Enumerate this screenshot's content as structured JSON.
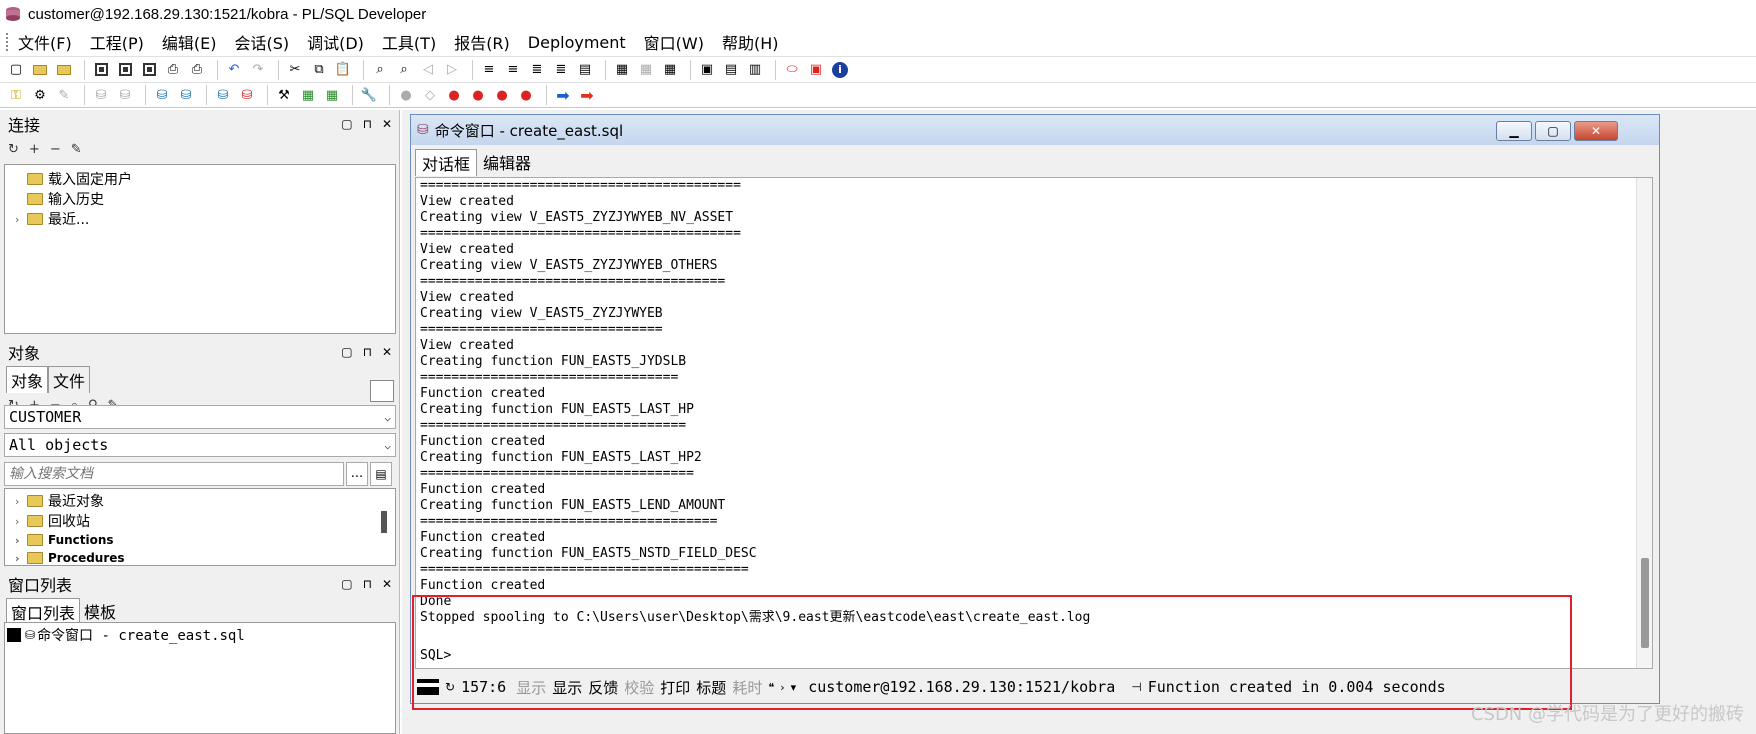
{
  "window": {
    "title": "customer@192.168.29.130:1521/kobra - PL/SQL Developer"
  },
  "menu": [
    "文件(F)",
    "工程(P)",
    "编辑(E)",
    "会话(S)",
    "调试(D)",
    "工具(T)",
    "报告(R)",
    "Deployment",
    "窗口(W)",
    "帮助(H)"
  ],
  "connection_panel": {
    "title": "连接",
    "tree": [
      {
        "label": "载入固定用户",
        "expandable": false
      },
      {
        "label": "输入历史",
        "expandable": false
      },
      {
        "label": "最近...",
        "expandable": true
      }
    ]
  },
  "objects_panel": {
    "title": "对象",
    "tabs": [
      "对象",
      "文件"
    ],
    "owner": "CUSTOMER",
    "filter": "All objects",
    "search_placeholder": "输入搜索文档",
    "search_more": "...",
    "tree": [
      {
        "label": "最近对象"
      },
      {
        "label": "回收站"
      },
      {
        "label": "Functions"
      },
      {
        "label": "Procedures"
      }
    ]
  },
  "windowlist_panel": {
    "title": "窗口列表",
    "tabs": [
      "窗口列表",
      "模板"
    ],
    "items": [
      "命令窗口 - create_east.sql"
    ]
  },
  "command_window": {
    "title": "命令窗口 - create_east.sql",
    "tabs": [
      "对话框",
      "编辑器"
    ],
    "output_lines": [
      "=========================================",
      "View created",
      "Creating view V_EAST5_ZYZJYWYEB_NV_ASSET",
      "=========================================",
      "View created",
      "Creating view V_EAST5_ZYZJYWYEB_OTHERS",
      "=======================================",
      "View created",
      "Creating view V_EAST5_ZYZJYWYEB",
      "===============================",
      "View created",
      "Creating function FUN_EAST5_JYDSLB",
      "=================================",
      "Function created",
      "Creating function FUN_EAST5_LAST_HP",
      "==================================",
      "Function created",
      "Creating function FUN_EAST5_LAST_HP2",
      "===================================",
      "Function created",
      "Creating function FUN_EAST5_LEND_AMOUNT",
      "======================================",
      "Function created",
      "Creating function FUN_EAST5_NSTD_FIELD_DESC",
      "==========================================",
      "Function created",
      "Done",
      "Stopped spooling to C:\\Users\\user\\Desktop\\需求\\9.east更新\\eastcode\\east\\create_east.log"
    ],
    "prompt": "SQL>",
    "status": {
      "position": "157:6",
      "btn_show_dim": "显示",
      "btn_show": "显示",
      "btn_feedback": "反馈",
      "btn_verify": "校验",
      "btn_print": "打印",
      "btn_heading": "标题",
      "btn_time": "耗时",
      "connection": "customer@192.168.29.130:1521/kobra",
      "message": "Function created in 0.004 seconds"
    }
  },
  "watermark": "CSDN @学代码是为了更好的搬砖"
}
